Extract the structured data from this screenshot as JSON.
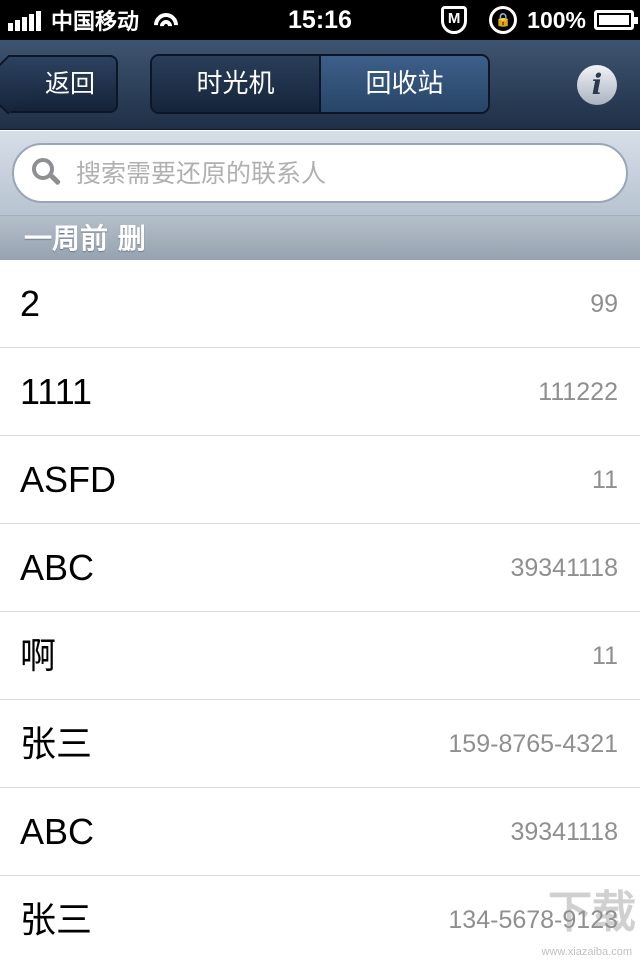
{
  "status_bar": {
    "carrier": "中国移动",
    "time": "15:16",
    "battery": "100%"
  },
  "nav": {
    "back_label": "返回",
    "tabs": [
      {
        "label": "时光机",
        "active": false
      },
      {
        "label": "回收站",
        "active": true
      }
    ],
    "info_label": "i"
  },
  "search": {
    "placeholder": "搜索需要还原的联系人"
  },
  "section": {
    "title": "一周前 删"
  },
  "contacts": [
    {
      "name": "2",
      "phone": "99"
    },
    {
      "name": "1111",
      "phone": "111222"
    },
    {
      "name": "ASFD",
      "phone": "11"
    },
    {
      "name": "ABC",
      "phone": "39341118"
    },
    {
      "name": "啊",
      "phone": "11"
    },
    {
      "name": "张三",
      "phone": "159-8765-4321"
    },
    {
      "name": "ABC",
      "phone": "39341118"
    },
    {
      "name": "张三",
      "phone": "134-5678-9123"
    }
  ],
  "watermark": {
    "glyph": "下载",
    "url": "www.xiazaiba.com"
  },
  "colors": {
    "nav_background": "#2a3d57",
    "active_tab": "#3a5a82",
    "section_header": "#a6b1be",
    "phone_text": "#8f8f8f"
  }
}
